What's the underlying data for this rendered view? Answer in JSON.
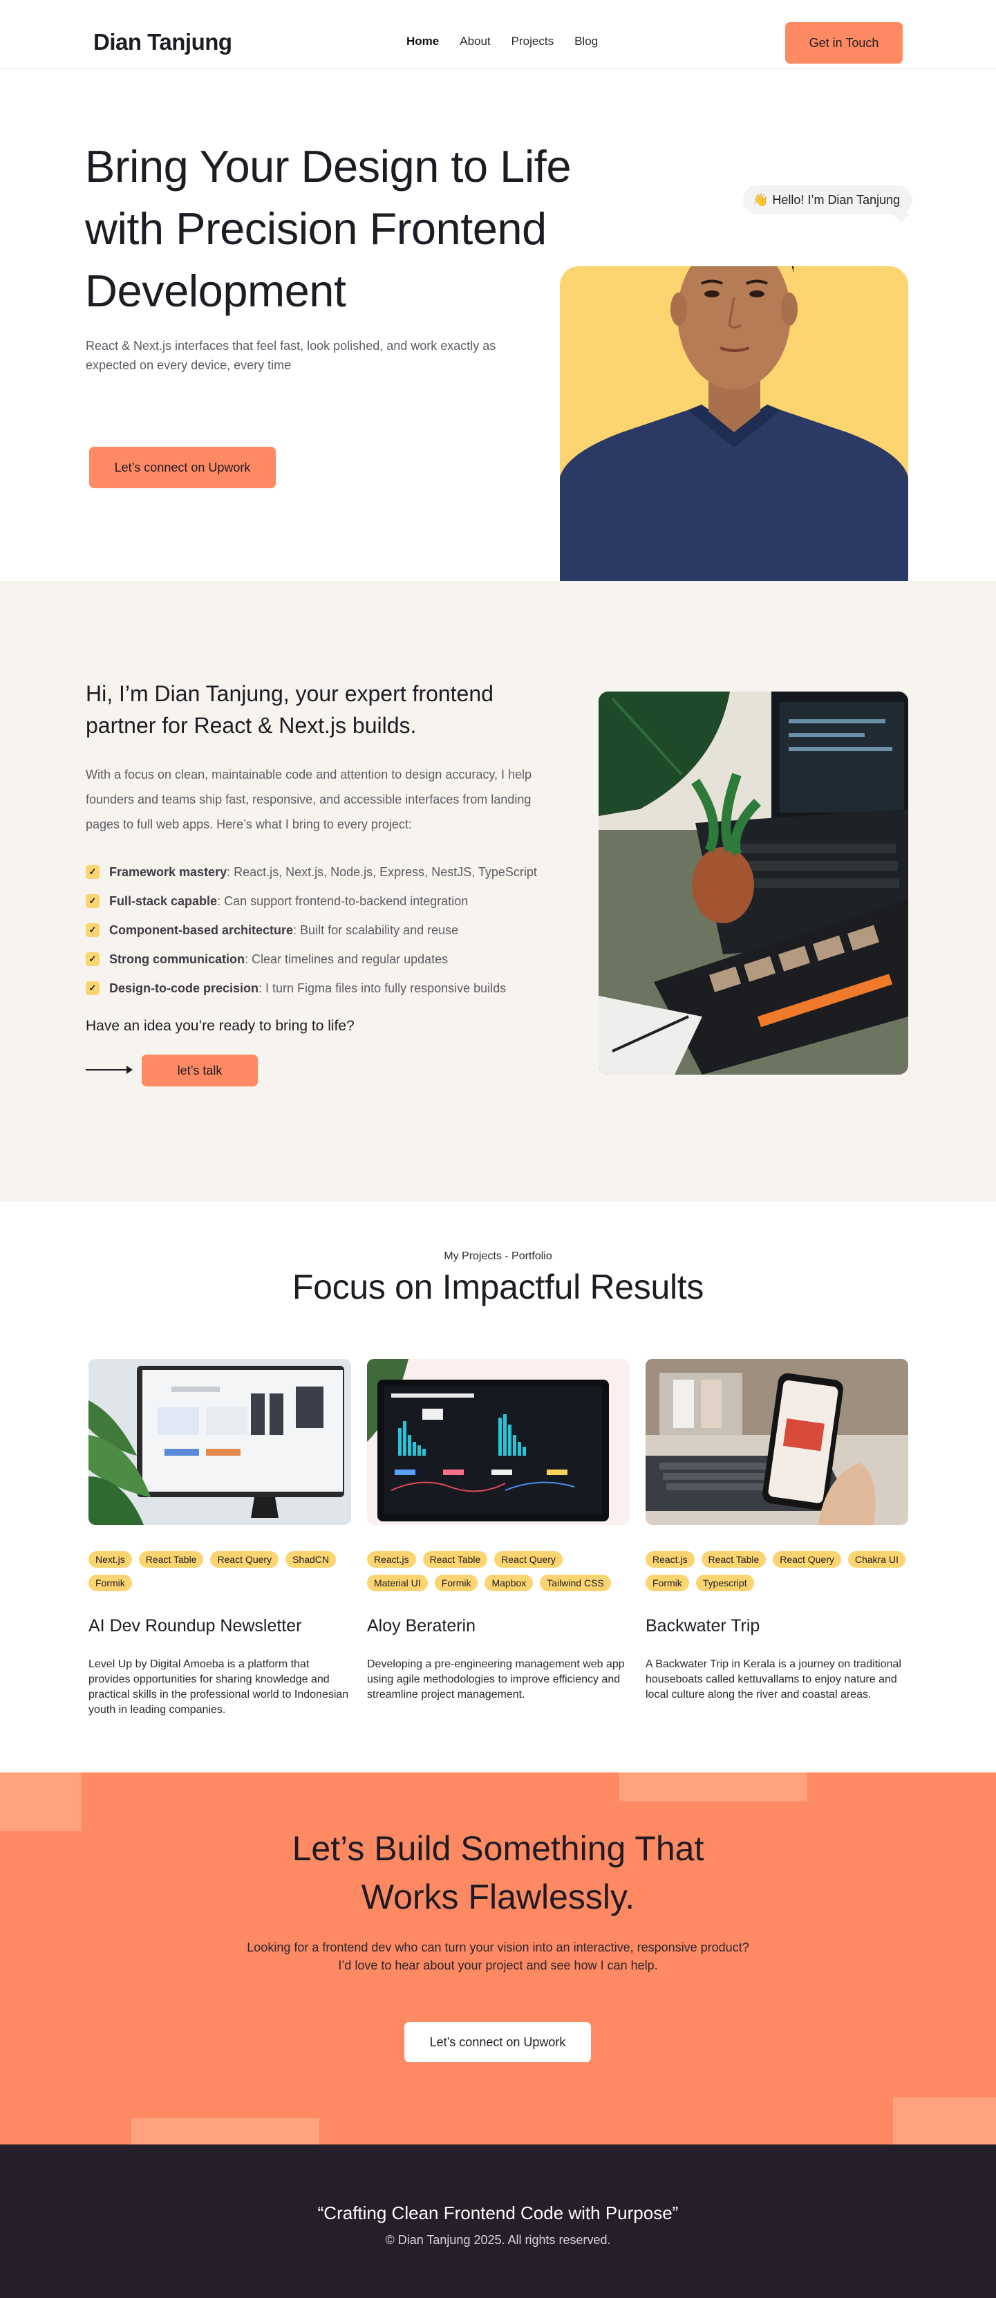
{
  "nav": {
    "brand": "Dian Tanjung",
    "links": [
      "Home",
      "About",
      "Projects",
      "Blog"
    ],
    "cta": "Get in Touch"
  },
  "hero": {
    "title": "Bring Your Design to Life with Precision Frontend Development",
    "subtitle": "React & Next.js interfaces that feel fast, look polished, and work exactly as expected on every device, every time",
    "cta": "Let’s connect on Upwork",
    "greeting": "Hello! I’m Dian Tanjung",
    "greeting_emoji": "👋"
  },
  "about": {
    "title": "Hi, I’m Dian Tanjung, your expert frontend partner for React & Next.js builds.",
    "body": "With a focus on clean, maintainable code and attention to design accuracy, I help founders and teams ship fast, responsive, and accessible interfaces from landing pages to full web apps. Here’s what I bring to every project:",
    "checks": [
      {
        "bold": "Framework mastery",
        "text": ": React.js, Next.js, Node.js, Express, NestJS, TypeScript"
      },
      {
        "bold": "Full-stack capable",
        "text": ": Can support frontend-to-backend integration"
      },
      {
        "bold": "Component-based architecture",
        "text": ": Built for scalability and reuse"
      },
      {
        "bold": "Strong communication",
        "text": ": Clear timelines and regular updates"
      },
      {
        "bold": "Design-to-code precision",
        "text": ": I turn Figma files into fully responsive builds"
      }
    ],
    "question": "Have an idea you’re ready to bring to life?",
    "talk": "let’s talk"
  },
  "projects": {
    "kicker": "My Projects - Portfolio",
    "title": "Focus on Impactful Results",
    "items": [
      {
        "tags": [
          "Next.js",
          "React Table",
          "React Query",
          "ShadCN",
          "Formik"
        ],
        "title": "AI Dev Roundup Newsletter",
        "desc": "Level Up by Digital Amoeba is a platform that provides opportunities for sharing knowledge and practical skills in the professional world to Indonesian youth in leading companies."
      },
      {
        "tags": [
          "React.js",
          "React Table",
          "React Query",
          "Material UI",
          "Formik",
          "Mapbox",
          "Tailwind CSS"
        ],
        "title": "Aloy Beraterin",
        "desc": "Developing a pre-engineering management web app using agile methodologies to improve efficiency and streamline project management."
      },
      {
        "tags": [
          "React.js",
          "React Table",
          "React Query",
          "Chakra UI",
          "Formik",
          "Typescript"
        ],
        "title": "Backwater Trip",
        "desc": "A Backwater Trip in Kerala is a journey on traditional houseboats called kettuvallams to enjoy nature and local culture along the river and coastal areas."
      }
    ]
  },
  "cta": {
    "title_line1": "Let’s Build Something That",
    "title_line2": "Works Flawlessly.",
    "sub_line1": "Looking for a frontend dev who can turn your vision into an interactive, responsive product?",
    "sub_line2": "I’d love to hear about your project and see how I can help.",
    "button": "Let’s connect on Upwork"
  },
  "footer": {
    "quote": "“Crafting Clean Frontend Code with Purpose”",
    "copyright": "© Dian Tanjung 2025. All rights reserved."
  },
  "colors": {
    "accent": "#fd8a62",
    "yellow": "#fcd571",
    "cream": "#f7f4ef",
    "dark": "#241f28"
  }
}
